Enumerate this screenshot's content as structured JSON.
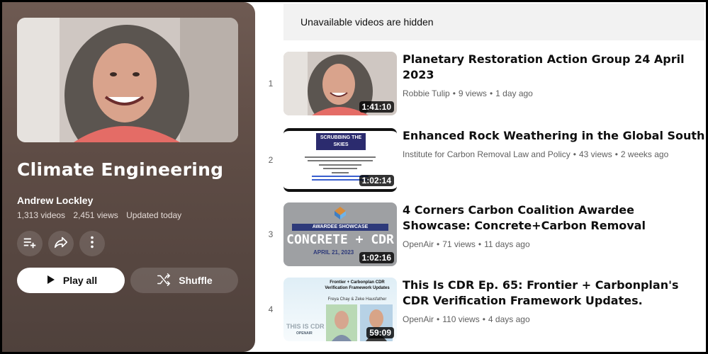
{
  "notice": {
    "text": "Unavailable videos are hidden"
  },
  "playlist": {
    "title": "Climate Engineering",
    "owner": "Andrew Lockley",
    "video_count": "1,313 videos",
    "views": "2,451 views",
    "updated": "Updated today",
    "play_all_label": "Play all",
    "shuffle_label": "Shuffle"
  },
  "icons": {
    "add_to_queue": "playlist-add-icon",
    "share": "share-icon",
    "more": "more-vert-icon",
    "play": "play-icon",
    "shuffle": "shuffle-icon"
  },
  "videos": [
    {
      "index": "1",
      "title": "Planetary Restoration Action Group 24 April 2023",
      "channel": "Robbie Tulip",
      "views": "9 views",
      "age": "1 day ago",
      "duration": "1:41:10"
    },
    {
      "index": "2",
      "title": "Enhanced Rock Weathering in the Global South",
      "channel": "Institute for Carbon Removal Law and Policy",
      "views": "43 views",
      "age": "2 weeks ago",
      "duration": "1:02:14",
      "thumb_text": {
        "banner": "SCRUBBING THE SKIES"
      }
    },
    {
      "index": "3",
      "title": "4 Corners Carbon Coalition Awardee Showcase: Concrete+Carbon Removal",
      "channel": "OpenAir",
      "views": "71 views",
      "age": "11 days ago",
      "duration": "1:02:16",
      "thumb_text": {
        "top": "AWARDEE SHOWCASE",
        "main": "CONCRETE + CDR",
        "date": "APRIL 21, 2023"
      }
    },
    {
      "index": "4",
      "title": "This Is CDR Ep. 65: Frontier + Carbonplan's CDR Verification Framework Updates.",
      "channel": "OpenAir",
      "views": "110 views",
      "age": "4 days ago",
      "duration": "59:09",
      "thumb_text": {
        "heading": "Frontier + Carbonplan CDR Verification Framework Updates",
        "guests": "Freya Chay & Zeke Hausfather",
        "brand": "THIS IS CDR",
        "brand2": "OPENAIR"
      }
    }
  ]
}
